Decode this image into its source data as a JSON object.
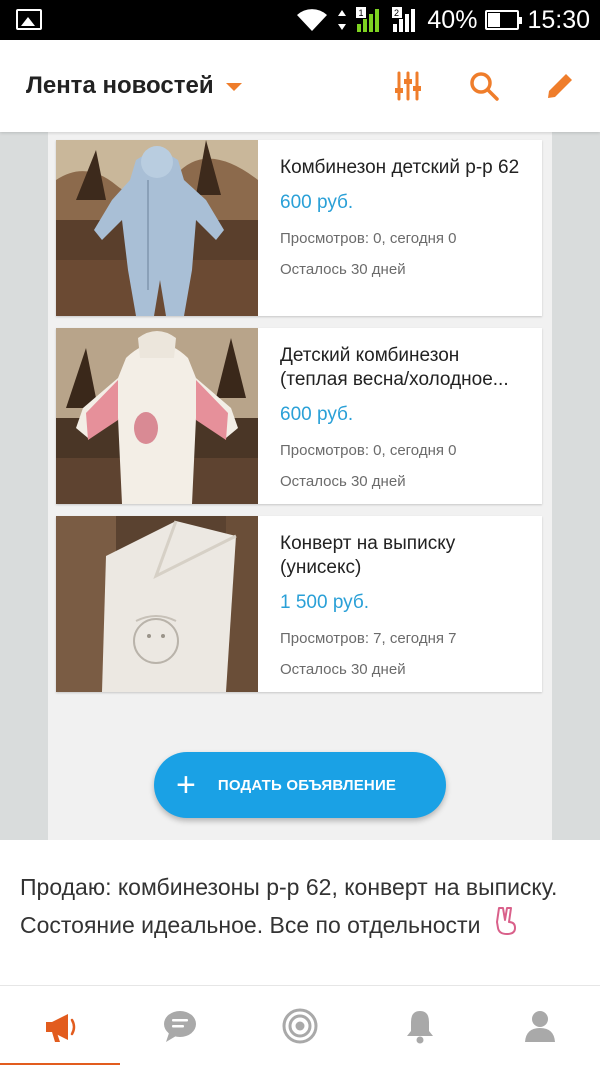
{
  "status_bar": {
    "battery": "40%",
    "time": "15:30",
    "icons": [
      "image-icon",
      "wifi-icon",
      "signal-sim1-icon",
      "signal-sim2-icon",
      "battery-icon"
    ]
  },
  "app_bar": {
    "title": "Лента новостей",
    "accent_color": "#ef7d2b",
    "icons": [
      "filter-sliders-icon",
      "search-icon",
      "pencil-icon"
    ]
  },
  "listings": [
    {
      "title": "Комбинезон детский р-р 62",
      "price": "600 руб.",
      "views": "Просмотров: 0, сегодня 0",
      "remaining": "Осталось 30 дней",
      "image": "blue-baby-jumpsuit-photo"
    },
    {
      "title": "Детский комбинезон (теплая весна/холодное...",
      "price": "600 руб.",
      "views": "Просмотров: 0, сегодня 0",
      "remaining": "Осталось 30 дней",
      "image": "white-pink-baby-jumpsuit-photo"
    },
    {
      "title": "Конверт на выписку (унисекс)",
      "price": "1 500 руб.",
      "views": "Просмотров: 7, сегодня 7",
      "remaining": "Осталось 30 дней",
      "image": "white-newborn-envelope-photo"
    }
  ],
  "fab": {
    "label": "ПОДАТЬ ОБЪЯВЛЕНИЕ",
    "color": "#1aa1e5"
  },
  "price_color": "#2aa0d7",
  "description": {
    "text": "Продаю: комбинезоны р-р 62, конверт на выписку. Состояние идеальное. Все по отдельности",
    "emoji": "victory-hand-icon"
  },
  "bottom_nav": {
    "items": [
      "megaphone-icon",
      "chat-icon",
      "target-icon",
      "bell-icon",
      "profile-icon"
    ],
    "active_index": 0,
    "active_color": "#e25c1e",
    "inactive_color": "#a9a9a9"
  }
}
